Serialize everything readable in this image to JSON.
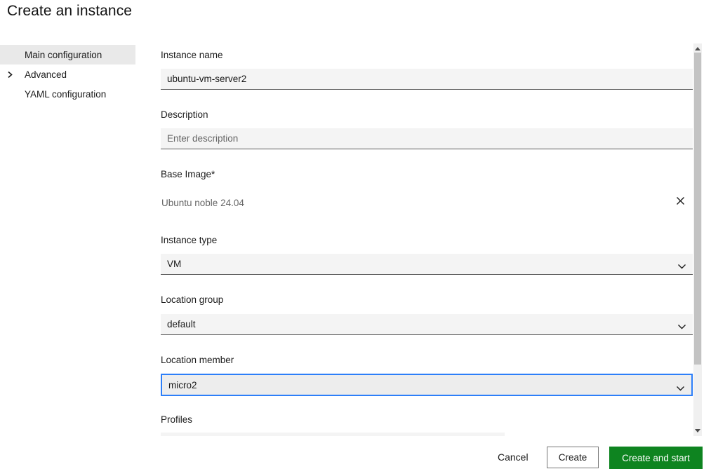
{
  "page_title": "Create an instance",
  "sidebar": {
    "items": [
      {
        "label": "Main configuration",
        "selected": true
      },
      {
        "label": "Advanced",
        "expandable": true
      },
      {
        "label": "YAML configuration",
        "selected": false
      }
    ]
  },
  "form": {
    "instance_name": {
      "label": "Instance name",
      "value": "ubuntu-vm-server2"
    },
    "description": {
      "label": "Description",
      "placeholder": "Enter description"
    },
    "base_image": {
      "label": "Base Image*",
      "value": "Ubuntu noble 24.04"
    },
    "instance_type": {
      "label": "Instance type",
      "value": "VM"
    },
    "location_group": {
      "label": "Location group",
      "value": "default"
    },
    "location_member": {
      "label": "Location member",
      "value": "micro2",
      "focused": true
    },
    "profiles": {
      "label": "Profiles"
    }
  },
  "footer": {
    "cancel_label": "Cancel",
    "create_label": "Create",
    "create_and_start_label": "Create and start"
  },
  "icons": {
    "sidebar_expand": "chevron-right-icon",
    "select_dropdown": "chevron-down-icon",
    "clear_base_image": "x-icon",
    "scrollbar_up": "triangle-up-icon",
    "scrollbar_down": "triangle-down-icon"
  },
  "colors": {
    "primary_green": "#0e8420",
    "focus_blue": "#2d7ff9",
    "input_background": "#f4f4f4",
    "input_border_bottom": "#595959",
    "sidebar_selected_background": "#e9e9e9",
    "muted_text": "#666666"
  }
}
